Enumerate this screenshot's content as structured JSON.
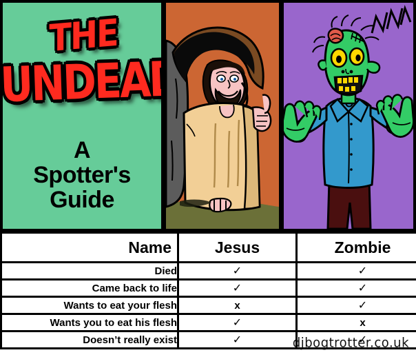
{
  "poster": {
    "title_line1": "THE",
    "title_line2": "UNDEAD",
    "subtitle": "A\nSpotter's\nGuide",
    "subtitle_line1": "A",
    "subtitle_line2": "Spotter's",
    "subtitle_line3": "Guide",
    "signature": "djbogtrotter.co.uk"
  },
  "colors": {
    "title_panel_bg": "#66cc99",
    "jesus_panel_bg": "#cc6633",
    "zombie_panel_bg": "#9966cc",
    "title_text": "#ff2a1f",
    "outline": "#000000",
    "ground": "#6b7038",
    "cave_rock": "#5c5c5c",
    "cave_mouth": "#7a4a22",
    "robe": "#f2cf96",
    "skin": "#f7c3c3",
    "zombie_skin": "#33cc66",
    "zombie_shirt": "#3399cc",
    "zombie_trousers": "#4a0f0f",
    "zombie_eye": "#ffd700",
    "zombie_brain": "#e05a4a"
  },
  "panels": [
    {
      "name": "title-panel",
      "caption": "THE UNDEAD - A Spotter's Guide"
    },
    {
      "name": "jesus-panel",
      "caption": "Jesus emerging from the tomb giving a thumbs up"
    },
    {
      "name": "zombie-panel",
      "caption": "Green zombie with arms raised and exposed brain"
    }
  ],
  "table": {
    "columns": [
      "Name",
      "Jesus",
      "Zombie"
    ],
    "rows": [
      {
        "label": "Died",
        "jesus": "✓",
        "zombie": "✓",
        "jesus_kind": "check",
        "zombie_kind": "check"
      },
      {
        "label": "Came back to life",
        "jesus": "✓",
        "zombie": "✓",
        "jesus_kind": "check",
        "zombie_kind": "check"
      },
      {
        "label": "Wants to eat your flesh",
        "jesus": "x",
        "zombie": "✓",
        "jesus_kind": "cross",
        "zombie_kind": "check"
      },
      {
        "label": "Wants you to eat his flesh",
        "jesus": "✓",
        "zombie": "x",
        "jesus_kind": "check",
        "zombie_kind": "cross"
      },
      {
        "label": "Doesn’t really exist",
        "jesus": "✓",
        "zombie": "✓",
        "jesus_kind": "check",
        "zombie_kind": "check"
      }
    ]
  }
}
